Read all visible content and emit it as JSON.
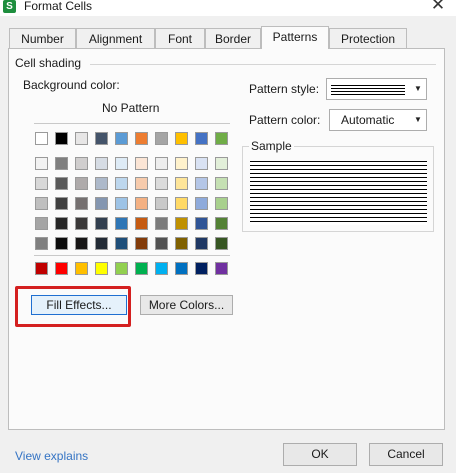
{
  "window": {
    "app_icon_letter": "S",
    "title": "Format Cells",
    "close_glyph": "✕"
  },
  "tabs": [
    {
      "label": "Number"
    },
    {
      "label": "Alignment"
    },
    {
      "label": "Font"
    },
    {
      "label": "Border"
    },
    {
      "label": "Patterns",
      "active": true
    },
    {
      "label": "Protection"
    }
  ],
  "cell_shading": {
    "group_label": "Cell shading",
    "background_label": "Background color:",
    "no_pattern_label": "No Pattern",
    "palette": {
      "top_row": [
        "#ffffff",
        "#000000",
        "#e7e6e6",
        "#44546a",
        "#5b9bd5",
        "#ed7d31",
        "#a5a5a5",
        "#ffc000",
        "#4472c4",
        "#70ad47"
      ],
      "tint_rows": [
        [
          "#f2f2f2",
          "#7f7f7f",
          "#d0cece",
          "#d6dce4",
          "#deebf6",
          "#fbe5d5",
          "#ededed",
          "#fff2cc",
          "#d9e2f3",
          "#e2efd9"
        ],
        [
          "#d8d8d8",
          "#595959",
          "#aeaaaa",
          "#adb9ca",
          "#bdd7ee",
          "#f7cbac",
          "#dbdbdb",
          "#fee599",
          "#b4c6e7",
          "#c5e0b3"
        ],
        [
          "#bfbfbf",
          "#3f3f3f",
          "#757070",
          "#8496b0",
          "#9dc3e6",
          "#f4b183",
          "#c9c9c9",
          "#ffd965",
          "#8eaadb",
          "#a8d08d"
        ],
        [
          "#a5a5a5",
          "#262626",
          "#3a3838",
          "#323f4f",
          "#2e75b5",
          "#c55a11",
          "#7b7b7b",
          "#bf9000",
          "#2f5496",
          "#538135"
        ],
        [
          "#7f7f7f",
          "#0c0c0c",
          "#171616",
          "#222a35",
          "#1e4e79",
          "#833c0b",
          "#525252",
          "#7f6000",
          "#1f3864",
          "#375623"
        ]
      ],
      "standard_row": [
        "#c00000",
        "#ff0000",
        "#ffc000",
        "#ffff00",
        "#92d050",
        "#00b050",
        "#00b0f0",
        "#0070c0",
        "#002060",
        "#7030a0"
      ]
    },
    "fill_effects_label": "Fill Effects...",
    "more_colors_label": "More Colors..."
  },
  "pattern": {
    "style_label": "Pattern style:",
    "color_label": "Pattern color:",
    "color_value": "Automatic",
    "sample_label": "Sample"
  },
  "footer": {
    "link_label": "View explains",
    "ok_label": "OK",
    "cancel_label": "Cancel"
  },
  "colors": {
    "highlight": "#d42020",
    "link": "#3574c4",
    "focus": "#1f6fd1"
  }
}
